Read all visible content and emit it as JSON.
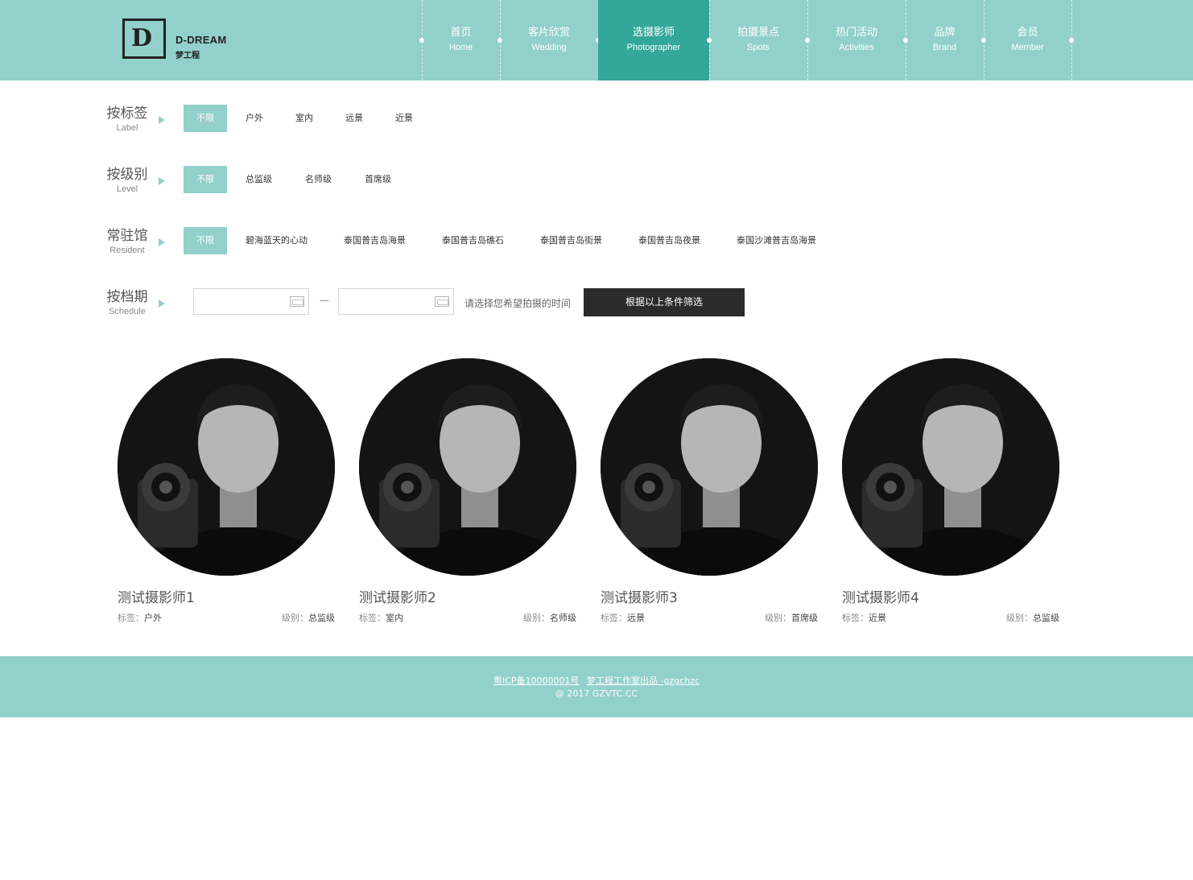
{
  "logo": {
    "en": "D-DREAM",
    "cn": "梦工程",
    "mark": "D"
  },
  "nav": [
    {
      "cn": "首页",
      "en": "Home"
    },
    {
      "cn": "客片欣赏",
      "en": "Wedding"
    },
    {
      "cn": "选摄影师",
      "en": "Photographer"
    },
    {
      "cn": "拍摄景点",
      "en": "Spots"
    },
    {
      "cn": "热门活动",
      "en": "Activities"
    },
    {
      "cn": "品牌",
      "en": "Brand"
    },
    {
      "cn": "会员",
      "en": "Member"
    }
  ],
  "filters": {
    "label": {
      "cn": "按标签",
      "en": "Label",
      "options": [
        "不限",
        "户外",
        "室内",
        "远景",
        "近景"
      ]
    },
    "level": {
      "cn": "按级别",
      "en": "Level",
      "options": [
        "不限",
        "总监级",
        "名师级",
        "首席级"
      ]
    },
    "resident": {
      "cn": "常驻馆",
      "en": "Resident",
      "options": [
        "不限",
        "碧海蓝天的心动",
        "泰国普吉岛海景",
        "泰国普吉岛礁石",
        "泰国普吉岛街景",
        "泰国普吉岛夜景",
        "泰国沙滩普吉岛海景"
      ]
    },
    "schedule": {
      "cn": "按档期",
      "en": "Schedule",
      "dash": "—",
      "hint": "请选择您希望拍摄的时间",
      "button": "根据以上条件筛选"
    }
  },
  "photographers": [
    {
      "name": "测试摄影师1",
      "tag_label": "标签：",
      "tag": "户外",
      "level_label": "级别：",
      "level": "总监级"
    },
    {
      "name": "测试摄影师2",
      "tag_label": "标签：",
      "tag": "室内",
      "level_label": "级别：",
      "level": "名师级"
    },
    {
      "name": "测试摄影师3",
      "tag_label": "标签：",
      "tag": "远景",
      "level_label": "级别：",
      "level": "首席级"
    },
    {
      "name": "测试摄影师4",
      "tag_label": "标签：",
      "tag": "近景",
      "level_label": "级别：",
      "level": "总监级"
    }
  ],
  "footer": {
    "icp": "粤ICP备10000001号",
    "studio": "梦工程工作室出品 -gzgchzc",
    "copy": "@ 2017 GZVTC.CC"
  },
  "colors": {
    "accent": "#92d0cb",
    "accent_dark": "#34a79b",
    "button": "#2b2b2b"
  }
}
